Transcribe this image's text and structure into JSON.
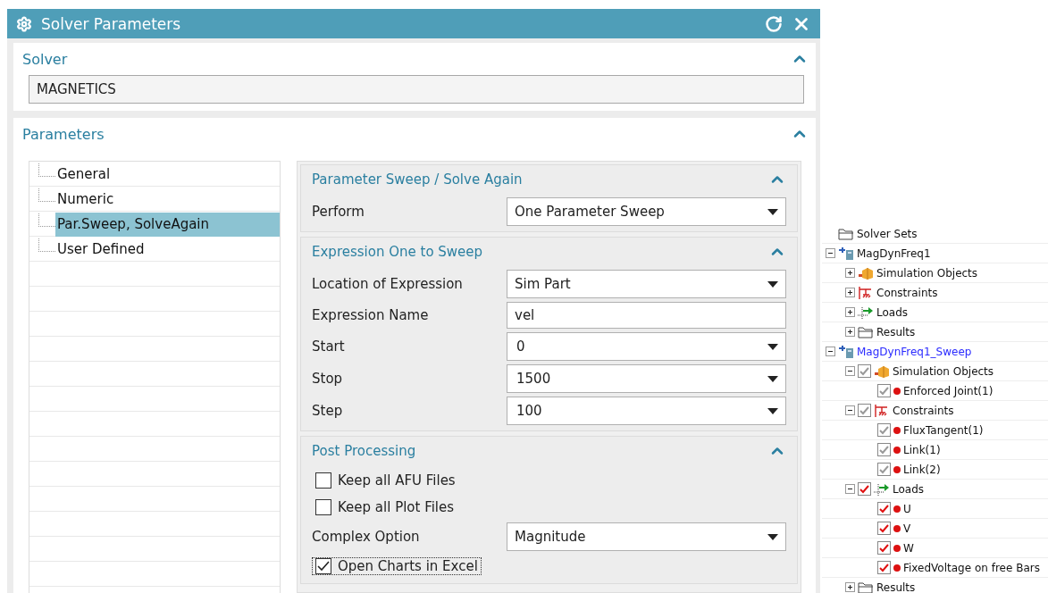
{
  "window": {
    "title": "Solver Parameters"
  },
  "solver": {
    "heading": "Solver",
    "expanded": true,
    "value": "MAGNETICS"
  },
  "parameters": {
    "heading": "Parameters",
    "expanded": true,
    "categories": [
      {
        "label": "General",
        "selected": false
      },
      {
        "label": "Numeric",
        "selected": false
      },
      {
        "label": "Par.Sweep, SolveAgain",
        "selected": true
      },
      {
        "label": "User Defined",
        "selected": false
      }
    ],
    "groups": [
      {
        "heading": "Parameter Sweep / Solve Again",
        "expanded": true,
        "fields": [
          {
            "kind": "dropdown",
            "label": "Perform",
            "value": "One Parameter Sweep"
          }
        ]
      },
      {
        "heading": "Expression One to Sweep",
        "expanded": true,
        "fields": [
          {
            "kind": "dropdown",
            "label": "Location of Expression",
            "value": "Sim Part"
          },
          {
            "kind": "text",
            "label": "Expression Name",
            "value": "vel"
          },
          {
            "kind": "combo",
            "label": "Start",
            "value": "0"
          },
          {
            "kind": "combo",
            "label": "Stop",
            "value": "1500"
          },
          {
            "kind": "combo",
            "label": "Step",
            "value": "100"
          }
        ]
      },
      {
        "heading": "Post Processing",
        "expanded": true,
        "fields": [
          {
            "kind": "checkbox",
            "label": "Keep all AFU Files",
            "checked": false,
            "focused": false
          },
          {
            "kind": "checkbox",
            "label": "Keep all Plot Files",
            "checked": false,
            "focused": false
          },
          {
            "kind": "dropdown",
            "label": "Complex Option",
            "value": "Magnitude"
          },
          {
            "kind": "checkbox",
            "label": "Open Charts in Excel",
            "checked": true,
            "focused": true
          }
        ]
      }
    ]
  },
  "tree": {
    "nodes": [
      {
        "kind": "folder",
        "label": "Solver Sets"
      },
      {
        "kind": "solution",
        "label": "MagDynFreq1",
        "active": false,
        "expanded": true,
        "children": [
          {
            "kind": "simulation-objects",
            "label": "Simulation Objects",
            "expanded": false
          },
          {
            "kind": "constraints",
            "label": "Constraints",
            "expanded": false
          },
          {
            "kind": "loads",
            "label": "Loads",
            "expanded": false
          },
          {
            "kind": "folder",
            "label": "Results",
            "expanded": false
          }
        ]
      },
      {
        "kind": "solution",
        "label": "MagDynFreq1_Sweep",
        "active": true,
        "expanded": true,
        "children": [
          {
            "kind": "simulation-objects",
            "label": "Simulation Objects",
            "expanded": true,
            "checked": true,
            "inherited": true,
            "children": [
              {
                "kind": "item",
                "label": "Enforced Joint(1)",
                "checked": true,
                "inherited": true
              }
            ]
          },
          {
            "kind": "constraints",
            "label": "Constraints",
            "expanded": true,
            "checked": true,
            "inherited": true,
            "children": [
              {
                "kind": "item",
                "label": "FluxTangent(1)",
                "checked": true,
                "inherited": true
              },
              {
                "kind": "item",
                "label": "Link(1)",
                "checked": true,
                "inherited": true
              },
              {
                "kind": "item",
                "label": "Link(2)",
                "checked": true,
                "inherited": true
              }
            ]
          },
          {
            "kind": "loads",
            "label": "Loads",
            "expanded": true,
            "checked": true,
            "inherited": false,
            "children": [
              {
                "kind": "item",
                "label": "U",
                "checked": true,
                "inherited": false
              },
              {
                "kind": "item",
                "label": "V",
                "checked": true,
                "inherited": false
              },
              {
                "kind": "item",
                "label": "W",
                "checked": true,
                "inherited": false
              },
              {
                "kind": "item",
                "label": "FixedVoltage on free Bars",
                "checked": true,
                "inherited": false
              }
            ]
          },
          {
            "kind": "folder",
            "label": "Results",
            "expanded": false
          }
        ]
      }
    ]
  }
}
